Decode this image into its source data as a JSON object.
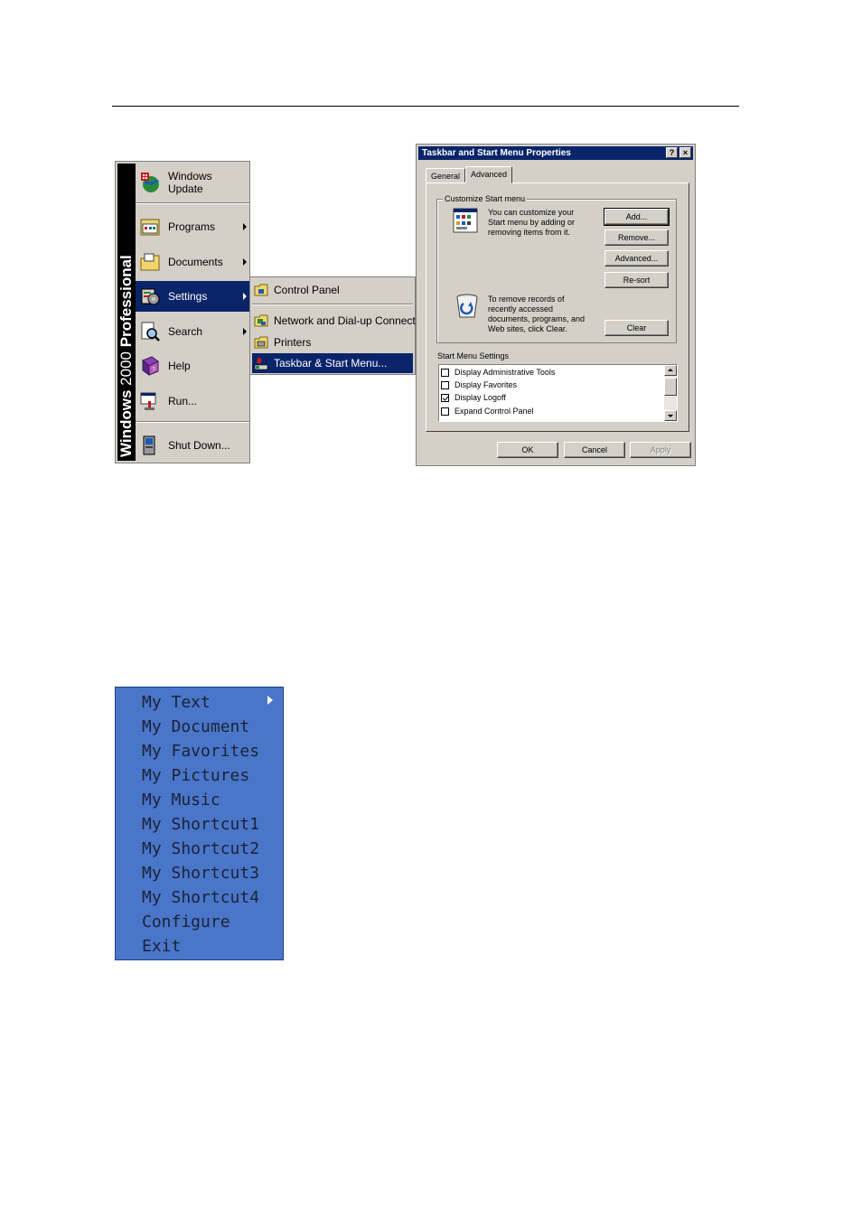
{
  "start_menu": {
    "banner_bold": "Windows",
    "banner_light": "2000",
    "banner_bold2": "Professional",
    "items": [
      {
        "label": "Windows Update",
        "icon": "windows-update-icon"
      },
      {
        "label": "Programs",
        "icon": "programs-icon"
      },
      {
        "label": "Documents",
        "icon": "documents-icon"
      },
      {
        "label": "Settings",
        "icon": "settings-icon"
      },
      {
        "label": "Search",
        "icon": "search-icon"
      },
      {
        "label": "Help",
        "icon": "help-icon"
      },
      {
        "label": "Run...",
        "icon": "run-icon"
      },
      {
        "label": "Shut Down...",
        "icon": "shut-down-icon"
      }
    ]
  },
  "settings_submenu": {
    "items": [
      {
        "label": "Control Panel",
        "icon": "control-panel-icon"
      },
      {
        "label": "Network and Dial-up Connections",
        "icon": "network-icon"
      },
      {
        "label": "Printers",
        "icon": "printers-icon"
      },
      {
        "label": "Taskbar & Start Menu...",
        "icon": "taskbar-icon"
      }
    ]
  },
  "dialog": {
    "title": "Taskbar and Start Menu Properties",
    "help_btn": "?",
    "close_btn": "×",
    "tabs": {
      "general": "General",
      "advanced": "Advanced"
    },
    "customize_group": "Customize Start menu",
    "customize_desc_1": "You can customize your",
    "customize_desc_2": "Start menu by adding or",
    "customize_desc_3": "removing items from it.",
    "btn_add": "Add...",
    "btn_remove": "Remove...",
    "btn_advanced": "Advanced...",
    "btn_resort": "Re-sort",
    "clear_desc_1": "To remove records of",
    "clear_desc_2": "recently accessed",
    "clear_desc_3": "documents, programs, and",
    "clear_desc_4": "Web sites,  click Clear.",
    "btn_clear": "Clear",
    "settings_group": "Start Menu Settings",
    "settings": [
      {
        "label": "Display Administrative Tools",
        "checked": false
      },
      {
        "label": "Display Favorites",
        "checked": false
      },
      {
        "label": "Display Logoff",
        "checked": true
      },
      {
        "label": "Expand Control Panel",
        "checked": false
      }
    ],
    "btn_ok": "OK",
    "btn_cancel": "Cancel",
    "btn_apply": "Apply"
  },
  "tray_menu": {
    "items": [
      "My Text",
      "My Document",
      "My Favorites",
      "My Pictures",
      "My Music",
      "My Shortcut1",
      "My Shortcut2",
      "My Shortcut3",
      "My Shortcut4",
      "Configure",
      "Exit"
    ]
  }
}
